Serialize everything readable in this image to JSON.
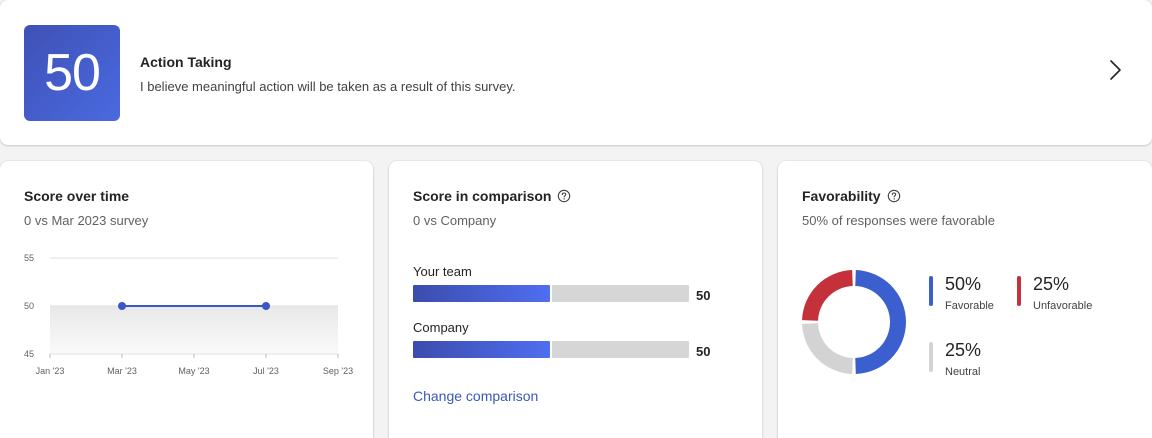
{
  "header": {
    "score": "50",
    "title": "Action Taking",
    "description": "I believe meaningful action will be taken as a result of this survey.",
    "chevron_icon": "chevron-right-icon"
  },
  "score_over_time": {
    "title": "Score over time",
    "subtitle": "0 vs Mar 2023 survey",
    "chart_data": {
      "type": "line",
      "x": [
        "Mar '23",
        "Jul '23"
      ],
      "values": [
        50,
        50
      ],
      "x_ticks": [
        "Jan '23",
        "Mar '23",
        "May '23",
        "Jul '23",
        "Sep '23"
      ],
      "y_ticks": [
        "55",
        "50",
        "45"
      ],
      "ylim": [
        45,
        55
      ],
      "color": "#3c57c8"
    }
  },
  "score_comparison": {
    "title": "Score in comparison",
    "subtitle": "0 vs Company",
    "bars": [
      {
        "label": "Your team",
        "value": 50,
        "value_label": "50"
      },
      {
        "label": "Company",
        "value": 50,
        "value_label": "50"
      }
    ],
    "max": 100,
    "link": "Change comparison"
  },
  "favorability": {
    "title": "Favorability",
    "subtitle": "50% of responses were favorable",
    "chart_data": {
      "type": "pie",
      "slices": [
        {
          "name": "Favorable",
          "value": 50,
          "label": "50%",
          "color": "#3c5fd0"
        },
        {
          "name": "Neutral",
          "value": 25,
          "label": "25%",
          "color": "#d3d3d3"
        },
        {
          "name": "Unfavorable",
          "value": 25,
          "label": "25%",
          "color": "#c4313a"
        }
      ]
    }
  }
}
